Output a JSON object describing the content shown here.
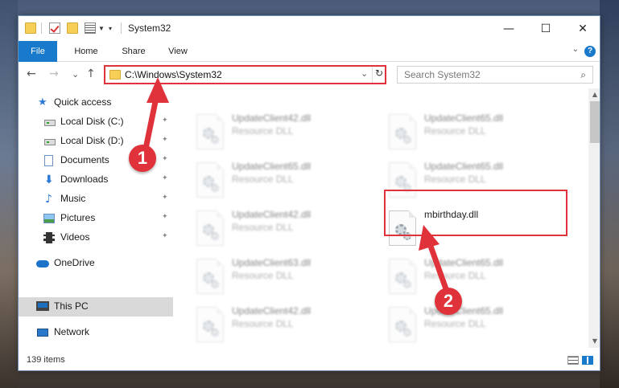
{
  "window": {
    "title": "System32",
    "controls": {
      "minimize": "—",
      "maximize": "☐",
      "close": "✕"
    }
  },
  "ribbon": {
    "tabs": [
      {
        "label": "File"
      },
      {
        "label": "Home"
      },
      {
        "label": "Share"
      },
      {
        "label": "View"
      }
    ],
    "expand_icon": "⌄",
    "help_icon": "?"
  },
  "nav": {
    "back": "←",
    "forward": "→",
    "recent": "⌄",
    "up": "↑",
    "address": "C:\\Windows\\System32",
    "address_chevron": "⌄",
    "refresh": "↻",
    "search_placeholder": "Search System32",
    "search_icon": "⌕"
  },
  "sidebar": {
    "items": [
      {
        "label": "Quick access",
        "icon": "star-icon"
      },
      {
        "label": "Local Disk (C:)",
        "icon": "drive-icon",
        "pinned": true
      },
      {
        "label": "Local Disk (D:)",
        "icon": "drive-icon",
        "pinned": true
      },
      {
        "label": "Documents",
        "icon": "document-icon",
        "pinned": true
      },
      {
        "label": "Downloads",
        "icon": "download-icon",
        "pinned": true
      },
      {
        "label": "Music",
        "icon": "music-icon",
        "pinned": true
      },
      {
        "label": "Pictures",
        "icon": "pictures-icon",
        "pinned": true
      },
      {
        "label": "Videos",
        "icon": "videos-icon",
        "pinned": true
      },
      {
        "label": "OneDrive",
        "icon": "cloud-icon"
      },
      {
        "label": "This PC",
        "icon": "computer-icon",
        "selected": true
      },
      {
        "label": "Network",
        "icon": "network-icon"
      }
    ],
    "pin_glyph": "📌"
  },
  "files": [
    {
      "name": "UpdateClient42.dll",
      "type": "Resource DLL"
    },
    {
      "name": "UpdateClient65.dll",
      "type": "Resource DLL"
    },
    {
      "name": "UpdateClient65.dll",
      "type": "Resource DLL"
    },
    {
      "name": "UpdateClient65.dll",
      "type": "Resource DLL"
    },
    {
      "name": "UpdateClient42.dll",
      "type": "Resource DLL"
    },
    {
      "name": "mbirthday.dll",
      "type": ""
    },
    {
      "name": "UpdateClient63.dll",
      "type": "Resource DLL"
    },
    {
      "name": "UpdateClient65.dll",
      "type": "Resource DLL"
    },
    {
      "name": "UpdateClient42.dll",
      "type": "Resource DLL"
    },
    {
      "name": "UpdateClient65.dll",
      "type": "Resource DLL"
    }
  ],
  "status": {
    "item_count": "139 items"
  },
  "callouts": [
    {
      "label": "1"
    },
    {
      "label": "2"
    }
  ],
  "colors": {
    "accent": "#1979ca",
    "highlight_red": "#e0323a",
    "selection": "#cce8ff"
  }
}
